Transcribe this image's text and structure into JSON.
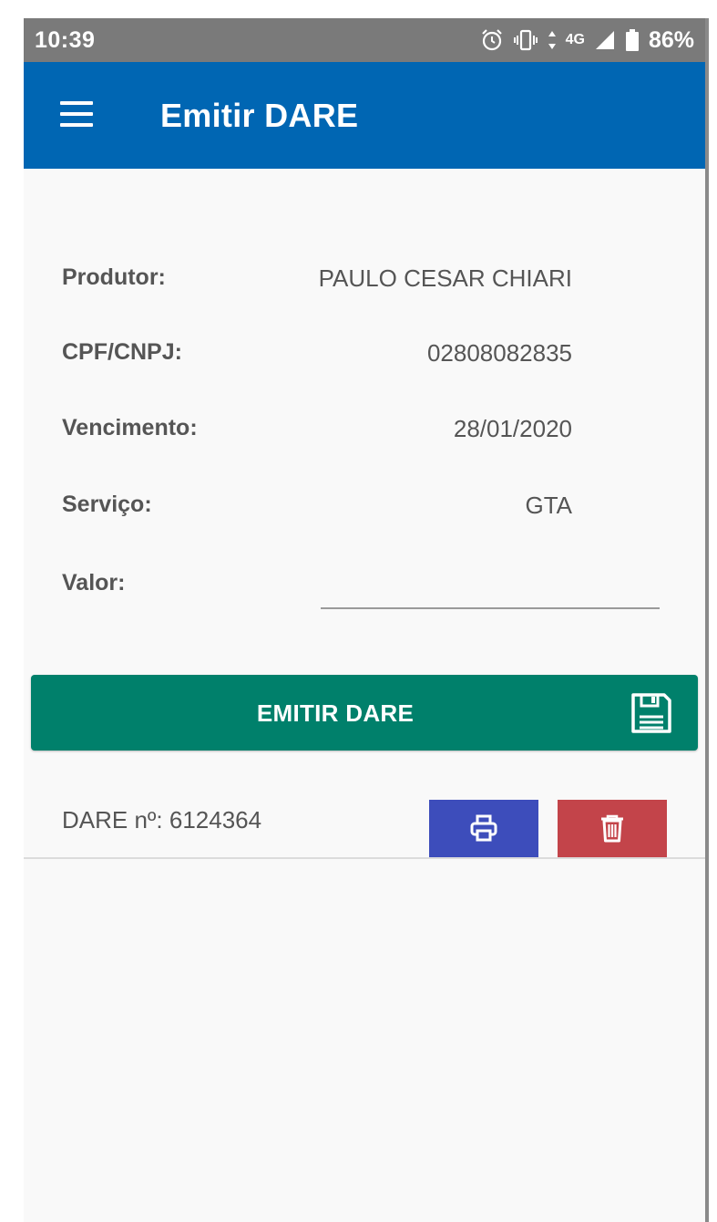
{
  "status_bar": {
    "time": "10:39",
    "network": "4G",
    "battery": "86%",
    "icons": [
      "alarm-icon",
      "vibrate-icon",
      "data-transfer-icon",
      "signal-icon",
      "battery-icon"
    ]
  },
  "app_bar": {
    "title": "Emitir DARE",
    "menu_icon": "hamburger-menu-icon",
    "color": "#0066b3"
  },
  "form": {
    "fields": [
      {
        "label": "Produtor:",
        "value": "PAULO CESAR CHIARI"
      },
      {
        "label": "CPF/CNPJ:",
        "value": "02808082835"
      },
      {
        "label": "Vencimento:",
        "value": "28/01/2020"
      },
      {
        "label": "Serviço:",
        "value": "GTA"
      }
    ],
    "valor": {
      "label": "Valor:",
      "value": "",
      "placeholder": ""
    }
  },
  "emit_button": {
    "label": "EMITIR DARE",
    "icon": "floppy-disk-icon",
    "color": "#00806b"
  },
  "dare_list": [
    {
      "label": "DARE nº: 6124364",
      "print_icon": "printer-icon",
      "delete_icon": "trash-icon",
      "print_color": "#3d4dbb",
      "delete_color": "#c3444a"
    }
  ]
}
